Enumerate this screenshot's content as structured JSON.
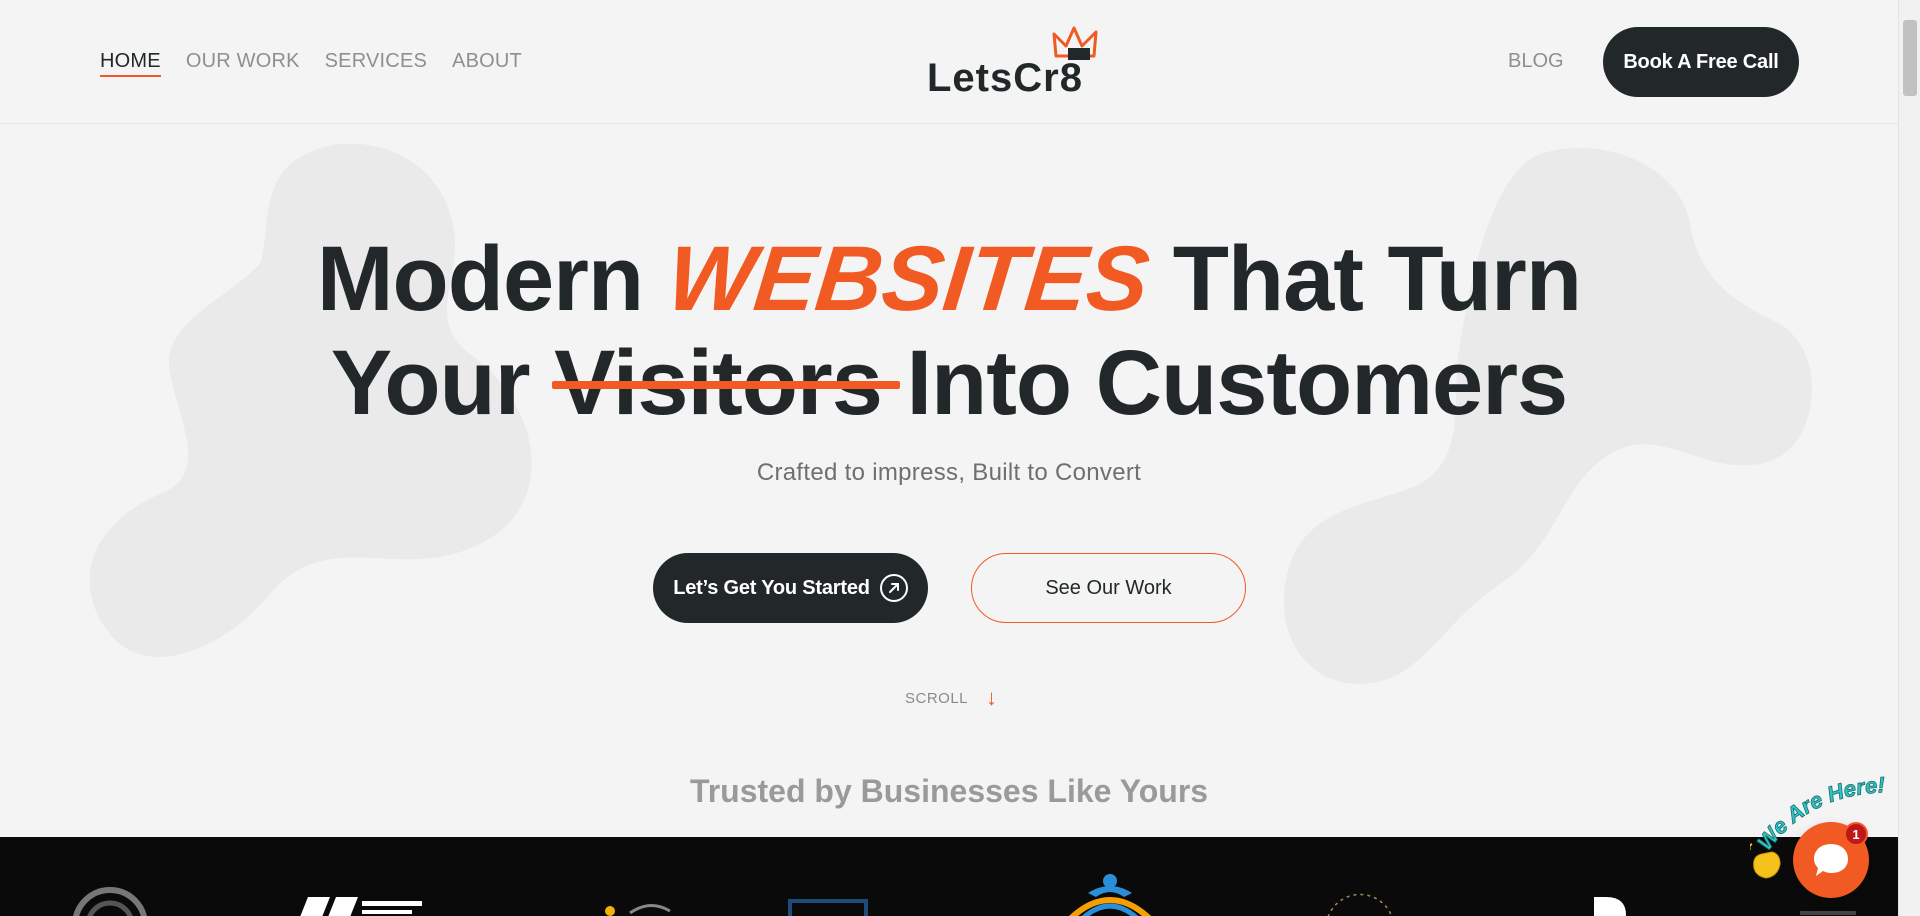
{
  "nav": {
    "items": [
      {
        "label": "HOME",
        "active": true
      },
      {
        "label": "OUR WORK",
        "active": false
      },
      {
        "label": "SERVICES",
        "active": false
      },
      {
        "label": "ABOUT",
        "active": false
      }
    ],
    "blog": "BLOG",
    "cta": "Book A Free Call"
  },
  "logo": {
    "text": "LetsCr8"
  },
  "hero": {
    "line1_before": "Modern ",
    "line1_highlight": "WEBSITES",
    "line1_after": " That Turn",
    "line2_before": "Your ",
    "line2_strike": "Visitors",
    "line2_after": " Into Customers",
    "subtitle": "Crafted to impress, Built to Convert",
    "primary_button": "Let’s Get You Started",
    "secondary_button": "See Our Work",
    "scroll": "SCROLL",
    "scroll_arrow": "↓"
  },
  "trusted": "Trusted by Businesses Like Yours",
  "chat": {
    "label": "We Are Here!",
    "badge": "1"
  },
  "colors": {
    "accent": "#f15a22",
    "dark": "#222829",
    "background": "#f4f4f4",
    "muted": "#8f8f8f"
  },
  "icons": {
    "primary_button": "arrow-up-right-circle-icon",
    "chat": "chat-bubble-icon",
    "wave": "waving-hand-icon"
  }
}
